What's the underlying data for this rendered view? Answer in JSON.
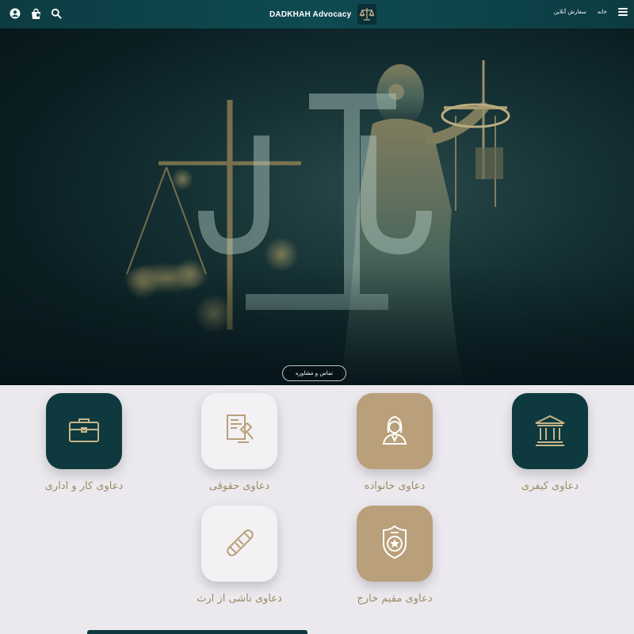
{
  "header": {
    "brand_title": "DADKHAH Advocacy",
    "nav_home": "خانه",
    "nav_order_online": "سفارش آنلاین",
    "icons": [
      "account-icon",
      "shopping-bag-icon",
      "search-icon",
      "menu-icon"
    ]
  },
  "hero": {
    "cta_label": "تماس و مشاوره"
  },
  "services": [
    {
      "label": "دعاوی کیفری",
      "icon": "courthouse-icon",
      "style": "dark"
    },
    {
      "label": "دعاوی خانواده",
      "icon": "woman-icon",
      "style": "gold"
    },
    {
      "label": "دعاوی حقوقی",
      "icon": "legal-document-icon",
      "style": "light"
    },
    {
      "label": "دعاوی کار و اداری",
      "icon": "briefcase-icon",
      "style": "dark"
    },
    {
      "label": "دعاوی مقیم خارج",
      "icon": "badge-icon",
      "style": "gold"
    },
    {
      "label": "دعاوی ناشی از ارث",
      "icon": "diploma-icon",
      "style": "light"
    }
  ],
  "colors": {
    "primary": "#0e3a3f",
    "gold": "#b9a07a",
    "label": "#9a8a62",
    "background": "#ebe9ee"
  }
}
